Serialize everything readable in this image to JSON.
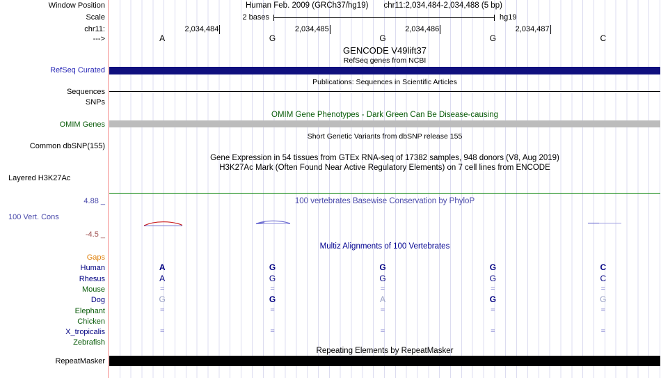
{
  "header": {
    "window_position_label": "Window Position",
    "scale_label": "Scale",
    "chrom_label": "chr11:",
    "direction_arrow": "--->",
    "assembly_title": "Human Feb. 2009 (GRCh37/hg19)",
    "position_title": "chr11:2,034,484-2,034,488 (5 bp)",
    "scale_value": "2 bases",
    "assembly_short": "hg19",
    "ruler_ticks": [
      "2,034,484",
      "2,034,485",
      "2,034,486",
      "2,034,487"
    ],
    "bases": [
      "A",
      "G",
      "G",
      "G",
      "C"
    ]
  },
  "tracks": {
    "gencode": {
      "title": "GENCODE V49lift37",
      "subtitle": "RefSeq genes from NCBI"
    },
    "refseq_curated": {
      "label": "RefSeq Curated"
    },
    "publications": {
      "caption": "Publications: Sequences in Scientific Articles",
      "label": "Sequences"
    },
    "snps": {
      "label": "SNPs"
    },
    "omim": {
      "caption": "OMIM Gene Phenotypes - Dark Green Can Be Disease-causing",
      "label": "OMIM Genes"
    },
    "dbsnp": {
      "caption": "Short Genetic Variants from dbSNP release 155",
      "label": "Common dbSNP(155)"
    },
    "gtex": {
      "caption": "Gene Expression in 54 tissues from GTEx RNA-seq of 17382 samples, 948 donors (V8, Aug 2019)"
    },
    "h3k27ac": {
      "caption": "H3K27Ac Mark (Often Found Near Active Regulatory Elements) on 7 cell lines from ENCODE",
      "label": "Layered H3K27Ac"
    },
    "conservation": {
      "caption": "100 vertebrates Basewise Conservation by PhyloP",
      "label": "100 Vert. Cons",
      "max_value": "4.88 _",
      "min_value": "-4.5 _"
    },
    "multiz": {
      "caption": "Multiz Alignments of 100 Vertebrates",
      "rows": [
        {
          "label": "Gaps",
          "label_color": "#e0820e",
          "cells": [
            "",
            "",
            "",
            "",
            ""
          ],
          "styles": [
            "",
            "",
            "",
            "",
            ""
          ]
        },
        {
          "label": "Human",
          "label_color": "#000082",
          "cells": [
            "A",
            "G",
            "G",
            "G",
            "C"
          ],
          "styles": [
            "strong",
            "strong",
            "strong",
            "strong",
            "strong"
          ]
        },
        {
          "label": "Rhesus",
          "label_color": "#000082",
          "cells": [
            "A",
            "G",
            "G",
            "G",
            "C"
          ],
          "styles": [
            "normal",
            "normal",
            "normal",
            "normal",
            "normal"
          ]
        },
        {
          "label": "Mouse",
          "label_color": "#0a5c0a",
          "cells": [
            "=",
            "=",
            "=",
            "=",
            "="
          ],
          "styles": [
            "eq",
            "eq",
            "eq",
            "eq",
            "eq"
          ]
        },
        {
          "label": "Dog",
          "label_color": "#000082",
          "cells": [
            "G",
            "G",
            "A",
            "G",
            "G"
          ],
          "styles": [
            "faint",
            "strong",
            "faint",
            "strong",
            "faint"
          ]
        },
        {
          "label": "Elephant",
          "label_color": "#0a5c0a",
          "cells": [
            "=",
            "=",
            "=",
            "=",
            "="
          ],
          "styles": [
            "eq",
            "eq",
            "eq",
            "eq",
            "eq"
          ]
        },
        {
          "label": "Chicken",
          "label_color": "#0a5c0a",
          "cells": [
            "",
            "",
            "",
            "",
            ""
          ],
          "styles": [
            "",
            "",
            "",
            "",
            ""
          ]
        },
        {
          "label": "X_tropicalis",
          "label_color": "#000082",
          "cells": [
            "=",
            "=",
            "=",
            "=",
            "="
          ],
          "styles": [
            "eq",
            "eq",
            "eq",
            "eq",
            "eq"
          ]
        },
        {
          "label": "Zebrafish",
          "label_color": "#0a5c0a",
          "cells": [
            "",
            "",
            "",
            "",
            ""
          ],
          "styles": [
            "",
            "",
            "",
            "",
            ""
          ]
        }
      ]
    },
    "repeatmasker": {
      "caption": "Repeating Elements by RepeatMasker",
      "label": "RepeatMasker"
    }
  },
  "colors": {
    "navy": "#000082",
    "green_label": "#0a5c0a",
    "orange_label": "#e0820e",
    "refseq_label": "#2323b5",
    "cons_label_blue": "#4848aa",
    "cons_label_red": "#a05252",
    "multiz_caption": "#000090",
    "refseq_bar": "#10107e",
    "omim_bar": "#bcbcbc",
    "repeat_bar": "#000000",
    "h3k_line": "#008000",
    "guide_line": "#dcdcf0",
    "edge_line": "#f49090",
    "faint_base": "#9aa2c6",
    "eq_base": "#8181d2",
    "wiggle_red": "#cc2020",
    "wiggle_blue": "#6a6ad0",
    "wiggle_blue_light": "#9a9ae0"
  }
}
